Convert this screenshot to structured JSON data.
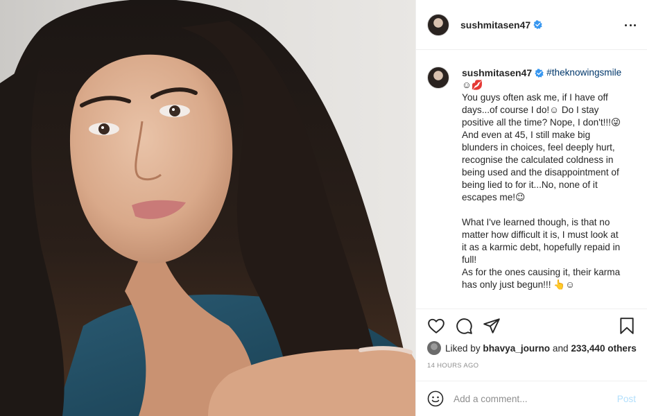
{
  "post": {
    "image_alt": "Portrait photo",
    "author": {
      "username": "sushmitasen47",
      "verified": true
    },
    "caption": {
      "hashtag": "#theknowingsmile",
      "first_line_emoji": "☺💋",
      "lines": [
        "You guys often ask me, if I have off",
        "days...of course I do!☺ Do I stay",
        "positive all the time? Nope, I don't!!!😜",
        "And even at 45, I still make big",
        "blunders in choices, feel deeply hurt,",
        "recognise the calculated coldness in",
        "being used and the disappointment of",
        "being lied to for it...No, none of it",
        "escapes me!😉",
        "",
        "What I've learned though, is that no",
        "matter how difficult it is, I must look at",
        "it as a karmic debt, hopefully repaid in",
        "full!",
        "As for the ones causing it, their karma",
        "has only just begun!!! 👆☺"
      ]
    },
    "likes": {
      "prefix": "Liked by",
      "liker": "bhavya_journo",
      "joiner": "and",
      "others": "233,440 others"
    },
    "timestamp": "14 HOURS AGO",
    "comment": {
      "placeholder": "Add a comment...",
      "post_label": "Post"
    }
  },
  "icons": {
    "like": "heart-outline-icon",
    "comment": "speech-bubble-icon",
    "share": "paper-plane-icon",
    "save": "bookmark-icon",
    "more": "ellipsis-icon",
    "verified": "verified-badge-icon",
    "emoji": "smiley-face-icon"
  },
  "colors": {
    "verified": "#3897f0",
    "hashtag": "#00376b",
    "post_disabled": "#b2dffc",
    "muted": "#8e8e8e",
    "text": "#262626"
  }
}
